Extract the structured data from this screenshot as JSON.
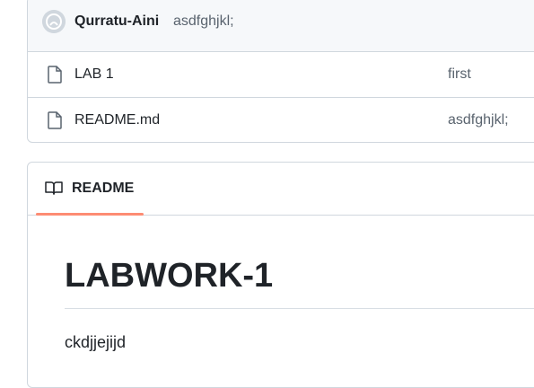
{
  "latest_commit": {
    "author": "Qurratu-Aini",
    "message": "asdfghjkl;"
  },
  "files": [
    {
      "name": "LAB 1",
      "commit_message": "first",
      "icon": "file-icon"
    },
    {
      "name": "README.md",
      "commit_message": "asdfghjkl;",
      "icon": "file-icon"
    }
  ],
  "readme": {
    "tab_label": "README",
    "tab_icon": "book-icon",
    "title": "LABWORK-1",
    "body_text": "ckdjjejijd",
    "accent_color": "#fd8c73"
  }
}
